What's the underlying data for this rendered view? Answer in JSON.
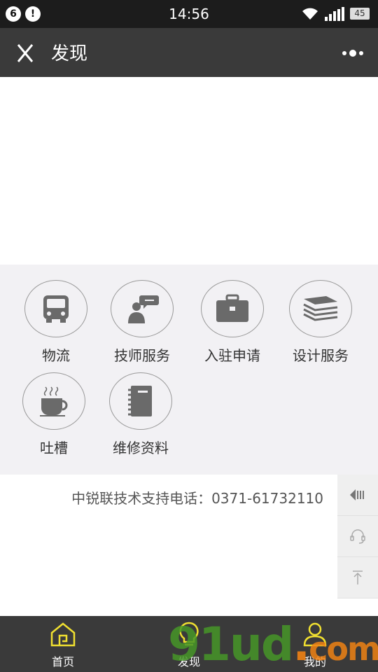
{
  "status_bar": {
    "badge_1": "6",
    "badge_2": "!",
    "time": "14:56",
    "battery": "45"
  },
  "title_bar": {
    "title": "发现",
    "close_icon": "close-icon",
    "more_icon": "more-dots-icon"
  },
  "grid": {
    "items": [
      {
        "label": "物流",
        "icon": "truck-icon"
      },
      {
        "label": "技师服务",
        "icon": "technician-chat-icon"
      },
      {
        "label": "入驻申请",
        "icon": "briefcase-icon"
      },
      {
        "label": "设计服务",
        "icon": "layers-stack-icon"
      },
      {
        "label": "吐槽",
        "icon": "coffee-cup-icon"
      },
      {
        "label": "维修资料",
        "icon": "notebook-icon"
      }
    ]
  },
  "hotline": "中锐联技术支持电话：0371-61732110",
  "side_buttons": [
    "back-arrow-icon",
    "headset-icon",
    "back-to-top-icon"
  ],
  "tab_bar": {
    "tabs": [
      {
        "label": "首页",
        "icon": "home-icon"
      },
      {
        "label": "发现",
        "icon": "lightbulb-icon"
      },
      {
        "label": "我的",
        "icon": "user-icon"
      }
    ]
  },
  "watermark": {
    "main": "91ud",
    "dot": ".",
    "suffix": "com"
  },
  "colors": {
    "accent": "#f0e030",
    "bar_bg": "#3a3a3a",
    "grid_bg": "#f2f1f4"
  }
}
